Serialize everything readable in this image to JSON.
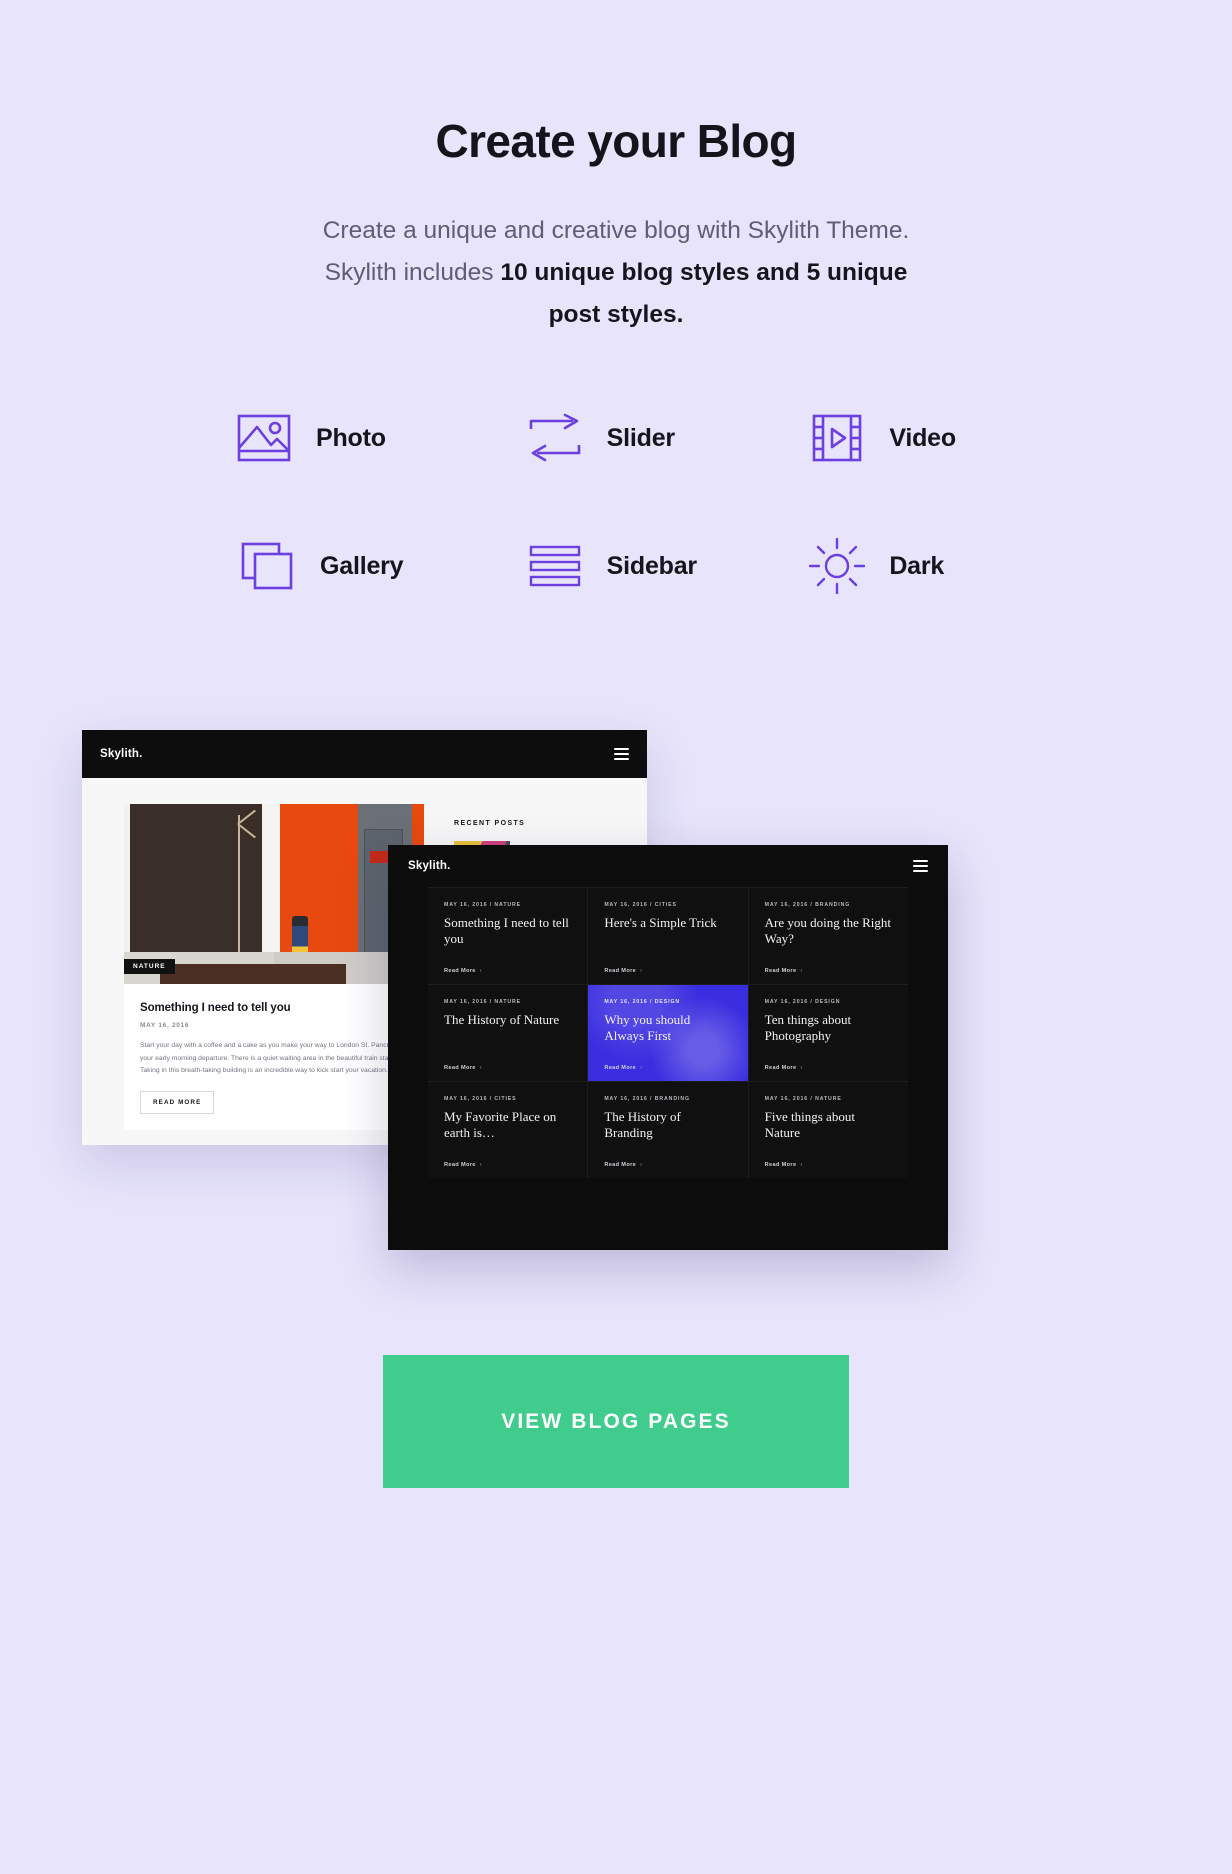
{
  "hero": {
    "title": "Create your Blog",
    "subtitle_part1": "Create a unique and creative blog with Skylith Theme. Skylith includes ",
    "subtitle_bold1": "10 unique blog styles and 5 unique post styles.",
    "subtitle_full": "Create a unique and creative blog with Skylith Theme. Skylith includes 10 unique blog styles and 5 unique post styles."
  },
  "features": [
    {
      "label": "Photo",
      "icon": "photo-icon"
    },
    {
      "label": "Slider",
      "icon": "slider-icon"
    },
    {
      "label": "Video",
      "icon": "video-icon"
    },
    {
      "label": "Gallery",
      "icon": "gallery-icon"
    },
    {
      "label": "Sidebar",
      "icon": "sidebar-icon"
    },
    {
      "label": "Dark",
      "icon": "sun-icon"
    }
  ],
  "mockup_light": {
    "logo": "Skylith.",
    "menu_icon": "hamburger-icon",
    "image_tag": "NATURE",
    "post_title": "Something I need to tell you",
    "post_date": "MAY 16, 2016",
    "post_excerpt": "Start your day with a coffee and a cake as you make your way to London St. Pancras for your early morning departure. There is a quiet waiting area in the beautiful train station. Taking in this breath-taking building is an incredible way to kick start your vacation.",
    "read_more_label": "READ MORE",
    "sidebar_heading": "RECENT POSTS"
  },
  "mockup_dark": {
    "logo": "Skylith.",
    "menu_icon": "hamburger-icon",
    "read_more_label": "Read More",
    "read_more_chevron": "›",
    "posts": [
      {
        "meta": "MAY 16, 2016 / NATURE",
        "title": "Something I need to tell you",
        "accent": false
      },
      {
        "meta": "MAY 16, 2016 / CITIES",
        "title": "Here's a Simple Trick",
        "accent": false
      },
      {
        "meta": "MAY 16, 2016 / BRANDING",
        "title": "Are you doing the Right Way?",
        "accent": false
      },
      {
        "meta": "MAY 16, 2016 / NATURE",
        "title": "The History of Nature",
        "accent": false
      },
      {
        "meta": "MAY 16, 2016 / DESIGN",
        "title": "Why you should Always First",
        "accent": true
      },
      {
        "meta": "MAY 16, 2016 / DESIGN",
        "title": "Ten things about Photography",
        "accent": false
      },
      {
        "meta": "MAY 16, 2016 / CITIES",
        "title": "My Favorite Place on earth is…",
        "accent": false
      },
      {
        "meta": "MAY 16, 2016 / BRANDING",
        "title": "The History of Branding",
        "accent": false
      },
      {
        "meta": "MAY 16, 2016 / NATURE",
        "title": "Five things about Nature",
        "accent": false
      }
    ]
  },
  "cta": {
    "label": "VIEW BLOG PAGES"
  },
  "colors": {
    "background": "#e7e4fb",
    "icon_purple": "#6c3fe0",
    "heading": "#15151c",
    "body_text": "#5f5e72",
    "cta_green": "#3fcc8c",
    "accent_blue": "#3b2ee0",
    "dark_panel": "#0c0c0c"
  }
}
